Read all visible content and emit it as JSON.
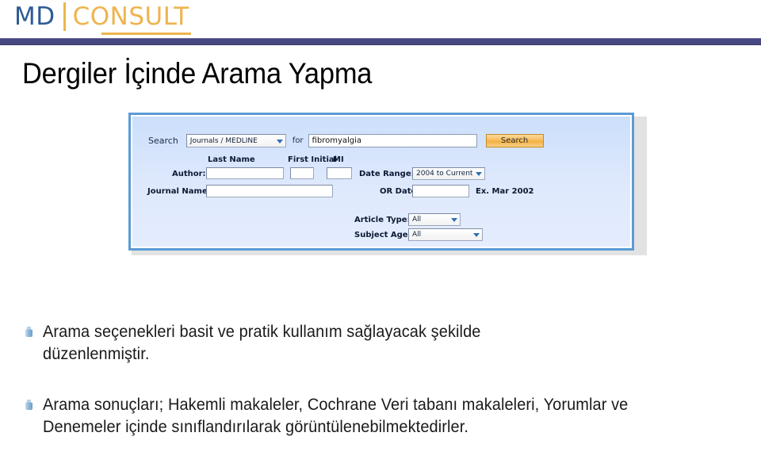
{
  "brand": {
    "md": "MD",
    "consult": "CONSULT",
    "bar_color": "#474782",
    "md_color": "#2e5b93",
    "consult_color": "#eeb44f"
  },
  "title": "Dergiler İçinde Arama Yapma",
  "search_panel": {
    "search_label": "Search",
    "source_value": "Journals / MEDLINE",
    "for_label": "for",
    "query_value": "fibromyalgia",
    "search_button": "Search",
    "column_headers": {
      "last_name": "Last Name",
      "first_initial": "First Initial",
      "mi": "MI"
    },
    "author_label": "Author:",
    "author_last_value": "",
    "author_first_value": "",
    "author_mi_value": "",
    "journal_label": "Journal Name:",
    "journal_value": "",
    "date_range_label": "Date Range:",
    "date_range_value": "2004 to Current",
    "or_date_label": "OR Date:",
    "or_date_value": "",
    "or_date_example": "Ex.  Mar 2002",
    "article_type_label": "Article Type:",
    "article_type_value": "All",
    "subject_age_label": "Subject Age:",
    "subject_age_value": "All",
    "accent_border": "#5b9bd5",
    "button_color": "#f2ae3d"
  },
  "bullets": [
    {
      "text": "Arama seçenekleri basit ve pratik kullanım sağlayacak şekilde düzenlenmiştir."
    },
    {
      "text": "Arama sonuçları; Hakemli makaleler, Cochrane Veri tabanı makaleleri, Yorumlar ve Denemeler içinde sınıflandırılarak görüntülenebilmektedirler."
    }
  ]
}
